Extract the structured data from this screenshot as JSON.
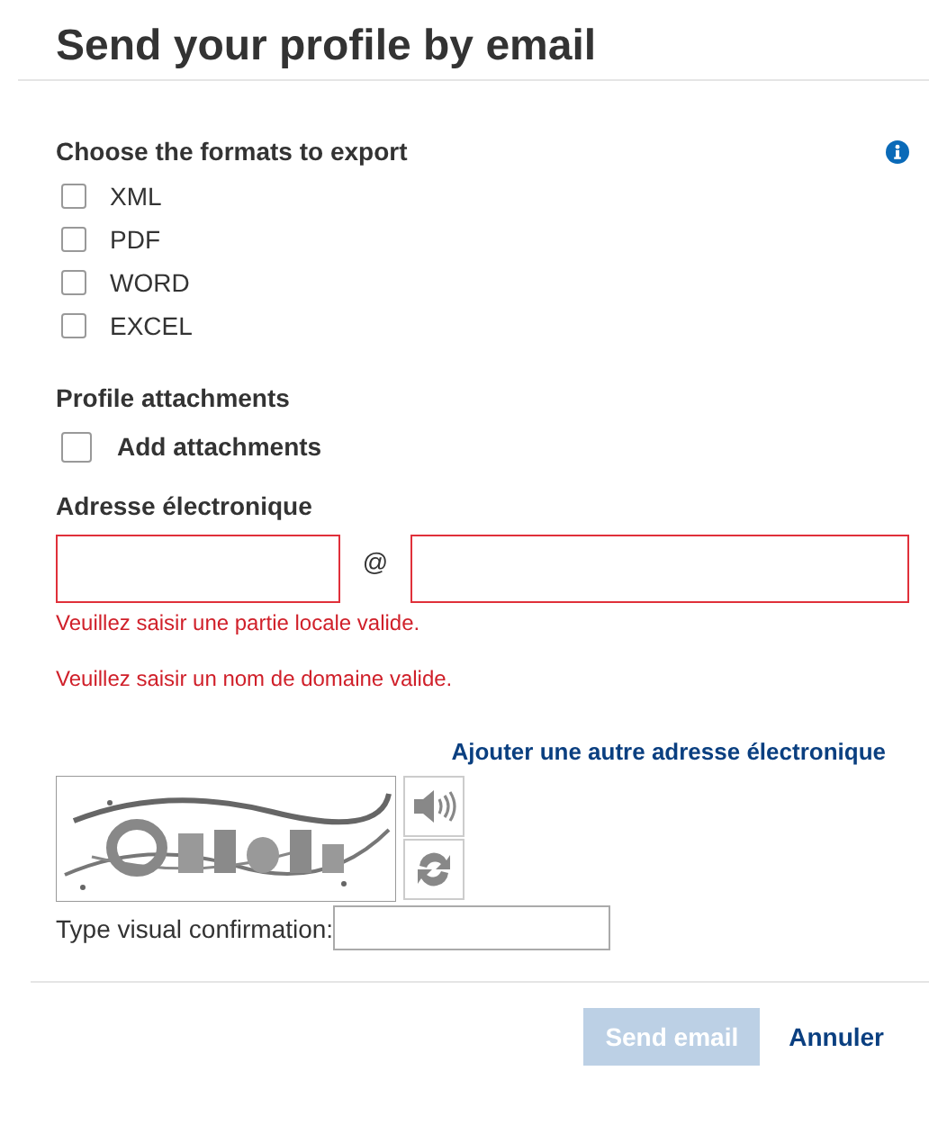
{
  "dialog": {
    "title": "Send your profile by email"
  },
  "formats": {
    "heading": "Choose the formats to export",
    "options": [
      {
        "label": "XML",
        "checked": false
      },
      {
        "label": "PDF",
        "checked": false
      },
      {
        "label": "WORD",
        "checked": false
      },
      {
        "label": "EXCEL",
        "checked": false
      }
    ]
  },
  "attachments": {
    "heading": "Profile attachments",
    "option": {
      "label": "Add attachments",
      "checked": false
    }
  },
  "email": {
    "label": "Adresse électronique",
    "separator": "@",
    "local_invalid": true,
    "domain_invalid": true,
    "errors": [
      "Veuillez saisir une partie locale valide.",
      "Veuillez saisir un nom de domaine valide."
    ],
    "add_link": "Ajouter une autre adresse électronique"
  },
  "captcha": {
    "label": "Type visual confirmation:"
  },
  "buttons": [
    {
      "label": "Send email",
      "kind": "primary",
      "disabled": true
    },
    {
      "label": "Annuler",
      "kind": "link",
      "disabled": false
    }
  ]
}
